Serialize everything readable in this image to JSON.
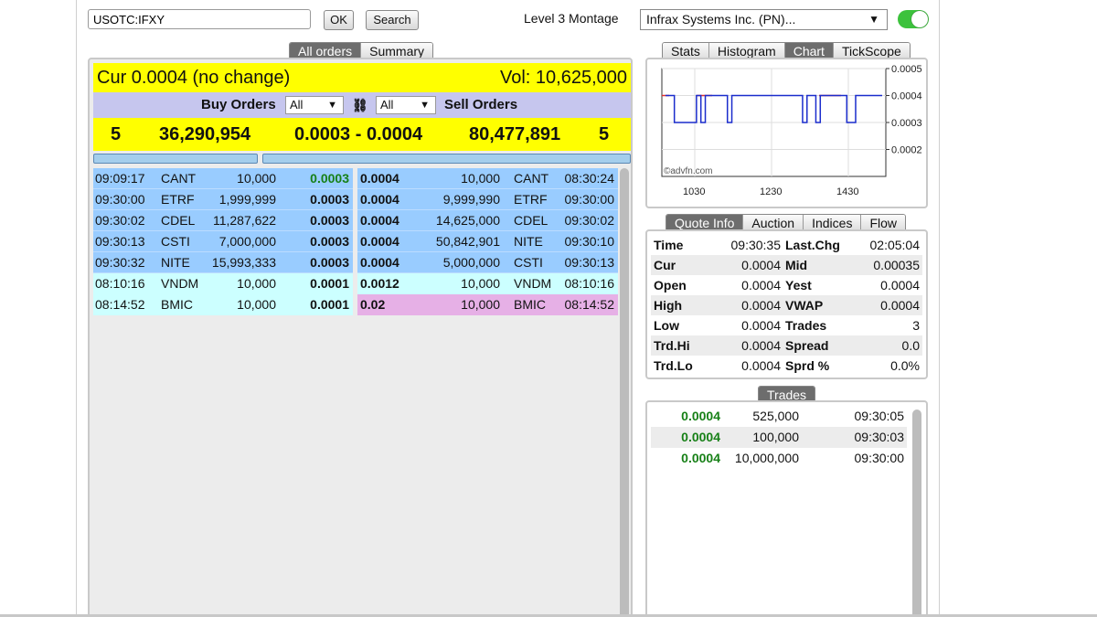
{
  "toolbar": {
    "symbol_value": "USOTC:IFXY",
    "ok_label": "OK",
    "search_label": "Search",
    "montage_label": "Level 3 Montage",
    "company_select": "Infrax Systems Inc. (PN)...",
    "toggle_on": true
  },
  "left_tabs": [
    "All orders",
    "Summary"
  ],
  "summary": {
    "cur": "Cur 0.0004 (no change)",
    "vol": "Vol: 10,625,000",
    "buy_orders_label": "Buy Orders",
    "sell_orders_label": "Sell Orders",
    "buy_filter": "All",
    "sell_filter": "All",
    "buy_count": "5",
    "buy_volume": "36,290,954",
    "spread": "0.0003 - 0.0004",
    "sell_volume": "80,477,891",
    "sell_count": "5"
  },
  "book": [
    {
      "b_time": "09:09:17",
      "b_mm": "CANT",
      "b_size": "10,000",
      "b_price": "0.0003",
      "s_price": "0.0004",
      "s_size": "10,000",
      "s_mm": "CANT",
      "s_time": "08:30:24",
      "b_level": "blue",
      "s_level": "blue",
      "b_green": true
    },
    {
      "b_time": "09:30:00",
      "b_mm": "ETRF",
      "b_size": "1,999,999",
      "b_price": "0.0003",
      "s_price": "0.0004",
      "s_size": "9,999,990",
      "s_mm": "ETRF",
      "s_time": "09:30:00",
      "b_level": "blue",
      "s_level": "blue",
      "b_green": false
    },
    {
      "b_time": "09:30:02",
      "b_mm": "CDEL",
      "b_size": "11,287,622",
      "b_price": "0.0003",
      "s_price": "0.0004",
      "s_size": "14,625,000",
      "s_mm": "CDEL",
      "s_time": "09:30:02",
      "b_level": "blue",
      "s_level": "blue",
      "b_green": false
    },
    {
      "b_time": "09:30:13",
      "b_mm": "CSTI",
      "b_size": "7,000,000",
      "b_price": "0.0003",
      "s_price": "0.0004",
      "s_size": "50,842,901",
      "s_mm": "NITE",
      "s_time": "09:30:10",
      "b_level": "blue",
      "s_level": "blue",
      "b_green": false
    },
    {
      "b_time": "09:30:32",
      "b_mm": "NITE",
      "b_size": "15,993,333",
      "b_price": "0.0003",
      "s_price": "0.0004",
      "s_size": "5,000,000",
      "s_mm": "CSTI",
      "s_time": "09:30:13",
      "b_level": "blue",
      "s_level": "blue",
      "b_green": false
    },
    {
      "b_time": "08:10:16",
      "b_mm": "VNDM",
      "b_size": "10,000",
      "b_price": "0.0001",
      "s_price": "0.0012",
      "s_size": "10,000",
      "s_mm": "VNDM",
      "s_time": "08:10:16",
      "b_level": "cyan",
      "s_level": "cyan",
      "b_green": false
    },
    {
      "b_time": "08:14:52",
      "b_mm": "BMIC",
      "b_size": "10,000",
      "b_price": "0.0001",
      "s_price": "0.02",
      "s_size": "10,000",
      "s_mm": "BMIC",
      "s_time": "08:14:52",
      "b_level": "cyan",
      "s_level": "pink",
      "b_green": false
    }
  ],
  "chart_tabs": [
    "Stats",
    "Histogram",
    "Chart",
    "TickScope"
  ],
  "chart_data": {
    "type": "line",
    "y_ticks": [
      "0.0005",
      "0.0004",
      "0.0003",
      "0.0002"
    ],
    "ylim": [
      0.0001,
      0.0005
    ],
    "x_ticks": [
      "1030",
      "1230",
      "1430"
    ],
    "watermark": "©advfn.com",
    "series": [
      {
        "color": "#1a2ccc",
        "values": [
          0.0004,
          0.0004,
          0.0003,
          0.0003,
          0.0003,
          0.0003,
          0.0003,
          0.0004,
          0.0003,
          0.0004,
          0.0004,
          0.0004,
          0.0004,
          0.0004,
          0.0003,
          0.0004,
          0.0004,
          0.0004,
          0.0004,
          0.0004,
          0.0004,
          0.0004,
          0.0004,
          0.0004,
          0.0004,
          0.0004,
          0.0004,
          0.0004,
          0.0004,
          0.0004,
          0.0004,
          0.0003,
          0.0004,
          0.0004,
          0.0003,
          0.0004,
          0.0004,
          0.0004,
          0.0004,
          0.0004,
          0.0004,
          0.0003,
          0.0003,
          0.0004,
          0.0004,
          0.0004,
          0.0004,
          0.0004,
          0.0004,
          0.0004
        ]
      }
    ]
  },
  "quote_tabs": [
    "Quote Info",
    "Auction",
    "Indices",
    "Flow"
  ],
  "quote": [
    {
      "l1": "Time",
      "v1": "09:30:35",
      "l2": "Last.Chg",
      "v2": "02:05:04"
    },
    {
      "l1": "Cur",
      "v1": "0.0004",
      "l2": "Mid",
      "v2": "0.00035"
    },
    {
      "l1": "Open",
      "v1": "0.0004",
      "l2": "Yest",
      "v2": "0.0004"
    },
    {
      "l1": "High",
      "v1": "0.0004",
      "l2": "VWAP",
      "v2": "0.0004"
    },
    {
      "l1": "Low",
      "v1": "0.0004",
      "l2": "Trades",
      "v2": "3"
    },
    {
      "l1": "Trd.Hi",
      "v1": "0.0004",
      "l2": "Spread",
      "v2": "0.0"
    },
    {
      "l1": "Trd.Lo",
      "v1": "0.0004",
      "l2": "Sprd %",
      "v2": "0.0%"
    }
  ],
  "trades_title": "Trades",
  "trades": [
    {
      "price": "0.0004",
      "size": "525,000",
      "time": "09:30:05"
    },
    {
      "price": "0.0004",
      "size": "100,000",
      "time": "09:30:03"
    },
    {
      "price": "0.0004",
      "size": "10,000,000",
      "time": "09:30:00"
    }
  ]
}
